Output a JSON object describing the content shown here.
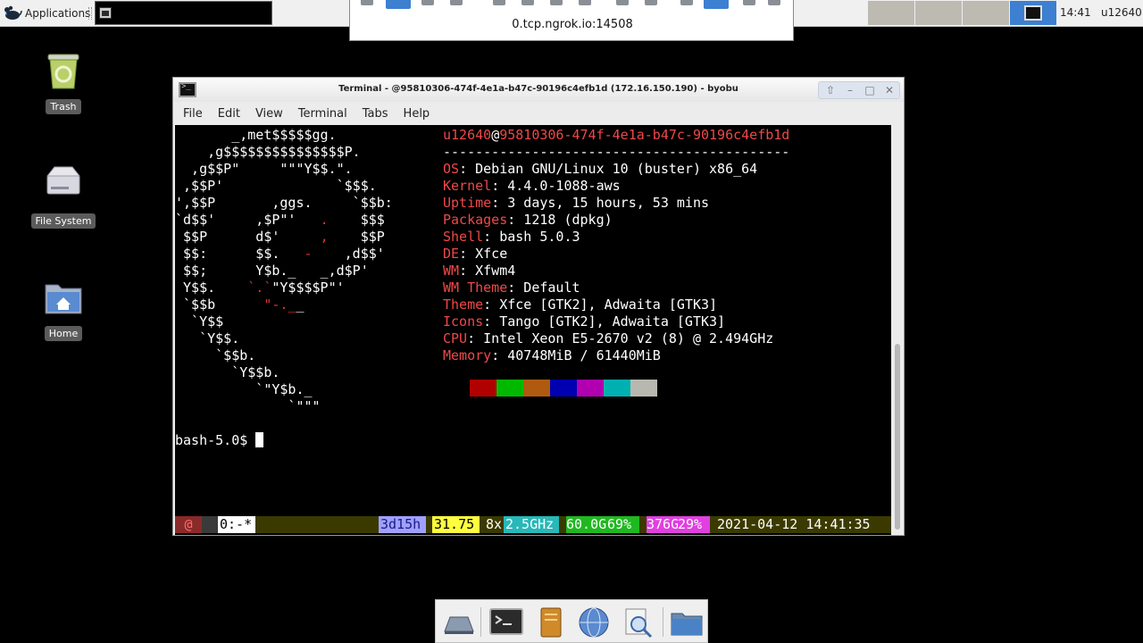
{
  "top_panel": {
    "applications_label": "Applications",
    "clock": "14:41",
    "user": "u12640"
  },
  "vnc": {
    "address": "0.tcp.ngrok.io:14508"
  },
  "desktop": {
    "icons": [
      {
        "label": "Trash"
      },
      {
        "label": "File System"
      },
      {
        "label": "Home"
      }
    ]
  },
  "terminal": {
    "title": "Terminal - @95810306-474f-4e1a-b47c-90196c4efb1d (172.16.150.190) - byobu",
    "menu": [
      "File",
      "Edit",
      "View",
      "Terminal",
      "Tabs",
      "Help"
    ],
    "neofetch": {
      "user": "u12640",
      "at": "@",
      "host": "95810306-474f-4e1a-b47c-90196c4efb1d",
      "separator": "-------------------------------------------",
      "fields": [
        {
          "key": "OS",
          "value": ": Debian GNU/Linux 10 (buster) x86_64"
        },
        {
          "key": "Kernel",
          "value": ": 4.4.0-1088-aws"
        },
        {
          "key": "Uptime",
          "value": ": 3 days, 15 hours, 53 mins"
        },
        {
          "key": "Packages",
          "value": ": 1218 (dpkg)"
        },
        {
          "key": "Shell",
          "value": ": bash 5.0.3"
        },
        {
          "key": "DE",
          "value": ": Xfce"
        },
        {
          "key": "WM",
          "value": ": Xfwm4"
        },
        {
          "key": "WM Theme",
          "value": ": Default"
        },
        {
          "key": "Theme",
          "value": ": Xfce [GTK2], Adwaita [GTK3]"
        },
        {
          "key": "Icons",
          "value": ": Tango [GTK2], Adwaita [GTK3]"
        },
        {
          "key": "CPU",
          "value": ": Intel Xeon E5-2670 v2 (8) @ 2.494GHz"
        },
        {
          "key": "Memory",
          "value": ": 40748MiB / 61440MiB"
        }
      ],
      "swatch_colors": [
        "#b00000",
        "#00b800",
        "#b05a10",
        "#0000b0",
        "#b000b0",
        "#00b0b0",
        "#b8b8b0"
      ]
    },
    "ascii_art": [
      "       _,met$$$$$gg.",
      "    ,g$$$$$$$$$$$$$$$P.",
      "  ,g$$P\"     \"\"\"Y$$.\".",
      " ,$$P'              `$$$.",
      "',$$P       ,ggs.     `$$b:",
      "`d$$'     ,$P\"'   .    $$$",
      " $$P      d$'     ,    $$P",
      " $$:      $$.   -    ,d$$'",
      " $$;      Y$b._   _,d$P'",
      " Y$$.    `.`\"Y$$$$P\"'",
      " `$$b      \"-.__",
      "  `Y$$",
      "   `Y$$.",
      "     `$$b.",
      "       `Y$$b.",
      "          `\"Y$b._",
      "              `\"\"\""
    ],
    "prompt": "bash-5.0$ ",
    "byobu": {
      "at": "@",
      "window": "0:-*",
      "uptime": "3d15h",
      "load": "31.75",
      "cpu_count": "8x",
      "cpu_freq": "2.5GHz",
      "mem_total": "60.0G",
      "mem_pct": "69%",
      "disk_total": "376G",
      "disk_pct": "29%",
      "datetime": "2021-04-12 14:41:35"
    }
  },
  "dock": {
    "items": [
      "show-desktop",
      "terminal",
      "file-manager",
      "web-browser",
      "app-finder",
      "folder"
    ]
  }
}
